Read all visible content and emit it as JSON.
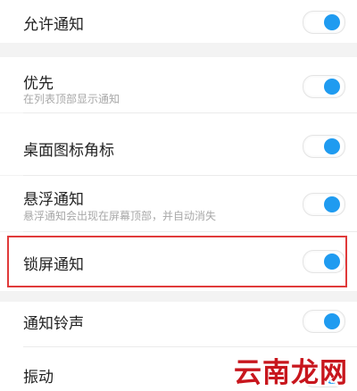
{
  "settings": {
    "allow": {
      "title": "允许通知",
      "on": true
    },
    "priority": {
      "title": "优先",
      "subtitle": "在列表顶部显示通知",
      "on": true
    },
    "badge": {
      "title": "桌面图标角标",
      "on": true
    },
    "floating": {
      "title": "悬浮通知",
      "subtitle": "悬浮通知会出现在屏幕顶部，并自动消失",
      "on": true
    },
    "lockscreen": {
      "title": "锁屏通知",
      "on": true
    },
    "ringtone": {
      "title": "通知铃声",
      "on": true
    },
    "vibrate": {
      "title": "振动",
      "on": true
    }
  },
  "watermark": {
    "text": "云南龙网"
  },
  "colors": {
    "accent": "#1f9bf0",
    "highlight_border": "#e03a3a",
    "watermark": "#c8161d",
    "background": "#f3f3f3"
  }
}
